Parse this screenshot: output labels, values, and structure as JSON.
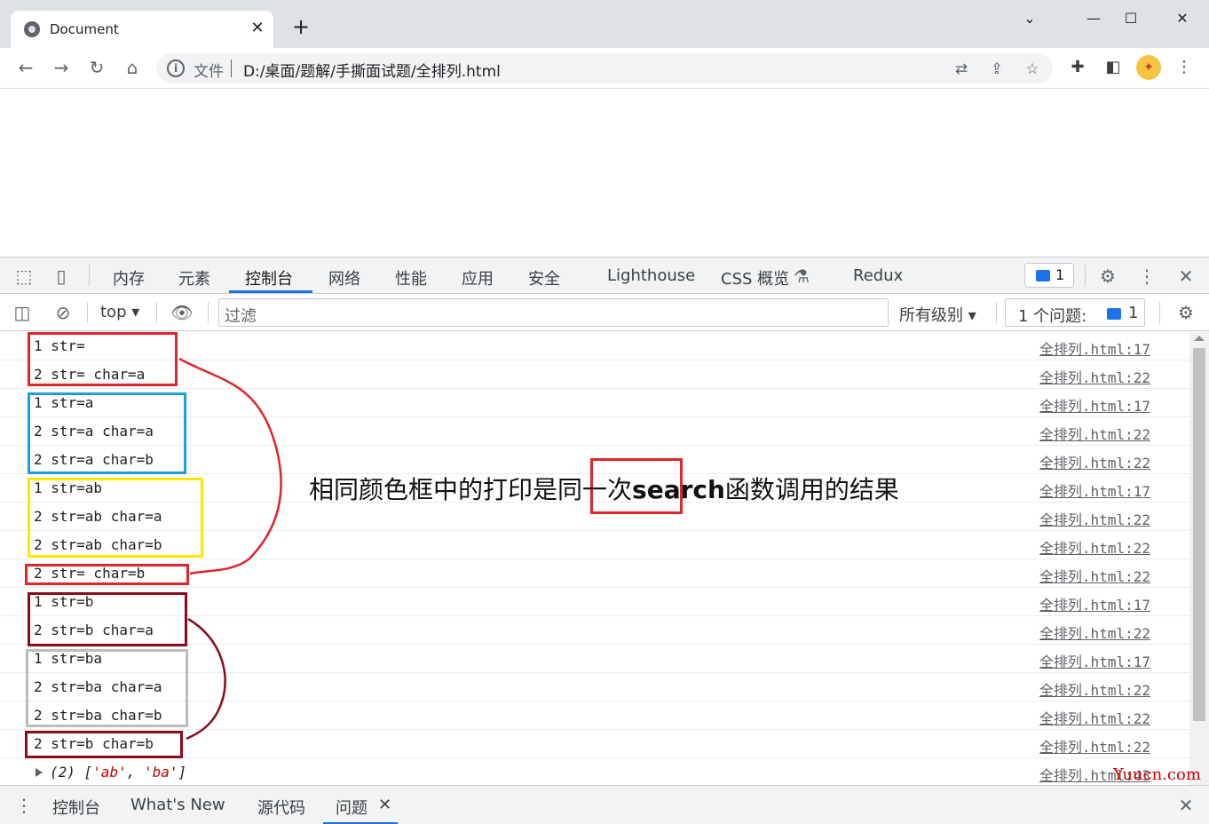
{
  "browser": {
    "tab_title": "Document",
    "tab_close": "✕",
    "new_tab": "+",
    "window_controls": {
      "minimize": "—",
      "maximize": "☐",
      "close": "✕"
    },
    "omnibox": {
      "scheme_label": "文件",
      "url": "D:/桌面/题解/手撕面试题/全排列.html"
    }
  },
  "devtools": {
    "tabs": [
      "内存",
      "元素",
      "控制台",
      "网络",
      "性能",
      "应用",
      "安全",
      "Lighthouse",
      "CSS 概览",
      "Redux"
    ],
    "active_tab": "控制台",
    "issues_badge_count": "1",
    "console_toolbar": {
      "context": "top",
      "filter_placeholder": "过滤",
      "levels": "所有级别",
      "issues_label": "1 个问题:",
      "issues_count": "1"
    },
    "console_rows": [
      {
        "msg": "1 str=",
        "src": "全排列.html:17"
      },
      {
        "msg": "2 str= char=a",
        "src": "全排列.html:22"
      },
      {
        "msg": "1 str=a",
        "src": "全排列.html:17"
      },
      {
        "msg": "2 str=a char=a",
        "src": "全排列.html:22"
      },
      {
        "msg": "2 str=a char=b",
        "src": "全排列.html:22"
      },
      {
        "msg": "1 str=ab",
        "src": "全排列.html:17"
      },
      {
        "msg": "2 str=ab char=a",
        "src": "全排列.html:22"
      },
      {
        "msg": "2 str=ab char=b",
        "src": "全排列.html:22"
      },
      {
        "msg": "2 str= char=b",
        "src": "全排列.html:22"
      },
      {
        "msg": "1 str=b",
        "src": "全排列.html:17"
      },
      {
        "msg": "2 str=b char=a",
        "src": "全排列.html:22"
      },
      {
        "msg": "1 str=ba",
        "src": "全排列.html:17"
      },
      {
        "msg": "2 str=ba char=a",
        "src": "全排列.html:22"
      },
      {
        "msg": "2 str=ba char=b",
        "src": "全排列.html:22"
      },
      {
        "msg": "2 str=b char=b",
        "src": "全排列.html:22"
      }
    ],
    "array_row": {
      "prefix": "(2) [",
      "items": [
        "'ab'",
        "'ba'"
      ],
      "sep": ", ",
      "suffix": "]",
      "src": "全排列.html:43"
    },
    "drawer_tabs": [
      "控制台",
      "What's New",
      "源代码",
      "问题"
    ],
    "drawer_active": "问题",
    "drawer_close_tab": "✕"
  },
  "annotation": {
    "text_before": "相同颜色框中的打印是",
    "text_boxed": "同一次",
    "text_bold": "search",
    "text_after": "函数调用的结果",
    "colors": {
      "red": "#e0252b",
      "blue": "#1aa0e0",
      "yellow": "#ffe600",
      "darkred": "#8b0a1e",
      "gray": "#bdbdbd"
    }
  },
  "watermark": "Yuucn.com",
  "icons": [
    "globe-icon",
    "back-icon",
    "forward-icon",
    "reload-icon",
    "home-icon",
    "info-icon",
    "translate-icon",
    "share-icon",
    "star-icon",
    "extensions-icon",
    "sidepanel-icon",
    "inspect-icon",
    "device-icon",
    "gear-icon",
    "kebab-icon",
    "close-icon",
    "sidebar-toggle-icon",
    "clear-icon",
    "eye-icon",
    "flask-icon"
  ]
}
